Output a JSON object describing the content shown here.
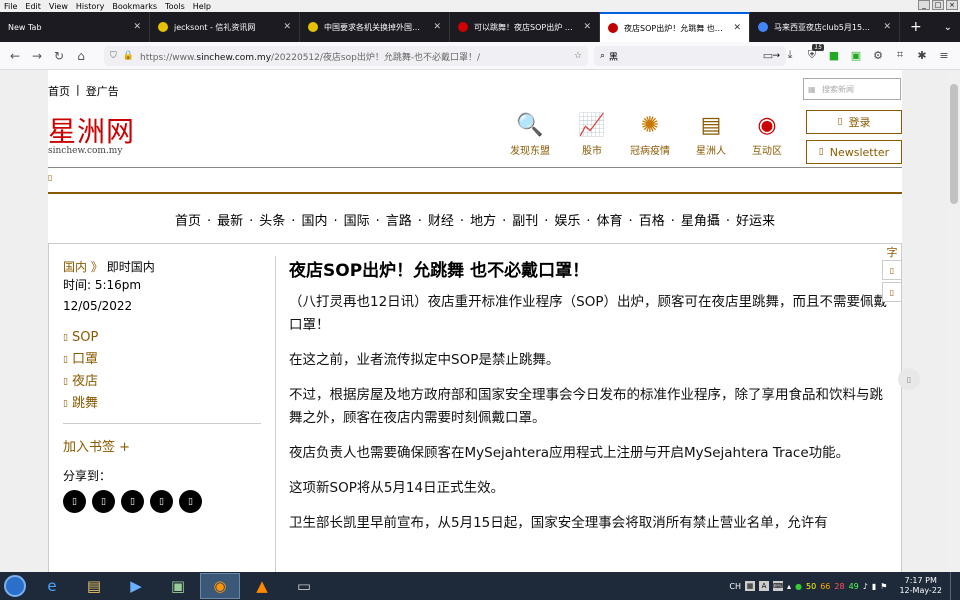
{
  "app_menu": [
    "File",
    "Edit",
    "View",
    "History",
    "Bookmarks",
    "Tools",
    "Help"
  ],
  "tabs": [
    {
      "title": "New Tab",
      "color": "#1c1b22",
      "active": false
    },
    {
      "title": "jecksont - 信礼资讯网",
      "color": "#e6c200",
      "active": false
    },
    {
      "title": "中国要求各机关换掉外国品牌电",
      "color": "#e6c200",
      "active": false
    },
    {
      "title": "可以跳舞！夜店SOP出炉 ❗ 5月1",
      "color": "#d00000",
      "active": false
    },
    {
      "title": "夜店SOP出炉！允跳舞 也不必戴",
      "color": "#c00000",
      "active": true
    },
    {
      "title": "马来西亚夜店club5月15日不用",
      "color": "#4285f4",
      "active": false
    }
  ],
  "newtab_label": "+",
  "url": {
    "prefix": "https://www.",
    "host": "sinchew.com.my",
    "path": "/20220512/夜店sop出炉！允跳舞-也不必戴口罩！/"
  },
  "search_value": "黑",
  "ext_badge": "15",
  "site": {
    "top_links": [
      "首页",
      "|",
      "登广告"
    ],
    "search_placeholder": "搜索新闻",
    "logo_cn": "星洲网",
    "logo_en": "sinchew.com.my",
    "quick_links": [
      {
        "label": "发现东盟",
        "icon": "discover-asean-icon"
      },
      {
        "label": "股市",
        "icon": "stock-chart-icon"
      },
      {
        "label": "冠病疫情",
        "icon": "virus-icon"
      },
      {
        "label": "星洲人",
        "icon": "sinchew-people-icon"
      },
      {
        "label": "互动区",
        "icon": "interactive-icon"
      }
    ],
    "login_label": "登录",
    "newsletter_label": "Newsletter",
    "main_nav": [
      "首页",
      "·",
      "最新",
      "·",
      "头条",
      "·",
      "国内",
      "·",
      "国际",
      "·",
      "言路",
      "·",
      "财经",
      "·",
      "地方",
      "·",
      "副刊",
      "·",
      "娱乐",
      "·",
      "体育",
      "·",
      "百格",
      "·",
      "星角攝",
      "·",
      "好运来"
    ]
  },
  "article": {
    "breadcrumb_parent": "国内",
    "breadcrumb_sep": "》",
    "breadcrumb_current": "即时国内",
    "time_label": "时间: 5:16pm",
    "date": "12/05/2022",
    "tags": [
      "SOP",
      "口罩",
      "夜店",
      "跳舞"
    ],
    "bookmark_label": "加入书签 +",
    "share_label": "分享到：",
    "title": "夜店SOP出炉！允跳舞 也不必戴口罩！",
    "paragraphs": [
      "（八打灵再也12日讯）夜店重开标准作业程序（SOP）出炉，顾客可在夜店里跳舞，而且不需要佩戴口罩！",
      "在这之前，业者流传拟定中SOP是禁止跳舞。",
      "不过，根据房屋及地方政府部和国家安全理事会今日发布的标准作业程序，除了享用食品和饮料与跳舞之外，顾客在夜店内需要时刻佩戴口罩。",
      "夜店负责人也需要确保顾客在MySejahtera应用程式上注册与开启MySejahtera Trace功能。",
      "这项新SOP将从5月14日正式生效。",
      "卫生部长凯里早前宣布，从5月15日起，国家安全理事会将取消所有禁止营业名单，允许有"
    ],
    "font_label": "字"
  },
  "taskbar": {
    "tray_lang": "CH",
    "tray_numbers": [
      "50",
      "66",
      "28",
      "49"
    ],
    "time": "7:17 PM",
    "date": "12-May-22"
  }
}
